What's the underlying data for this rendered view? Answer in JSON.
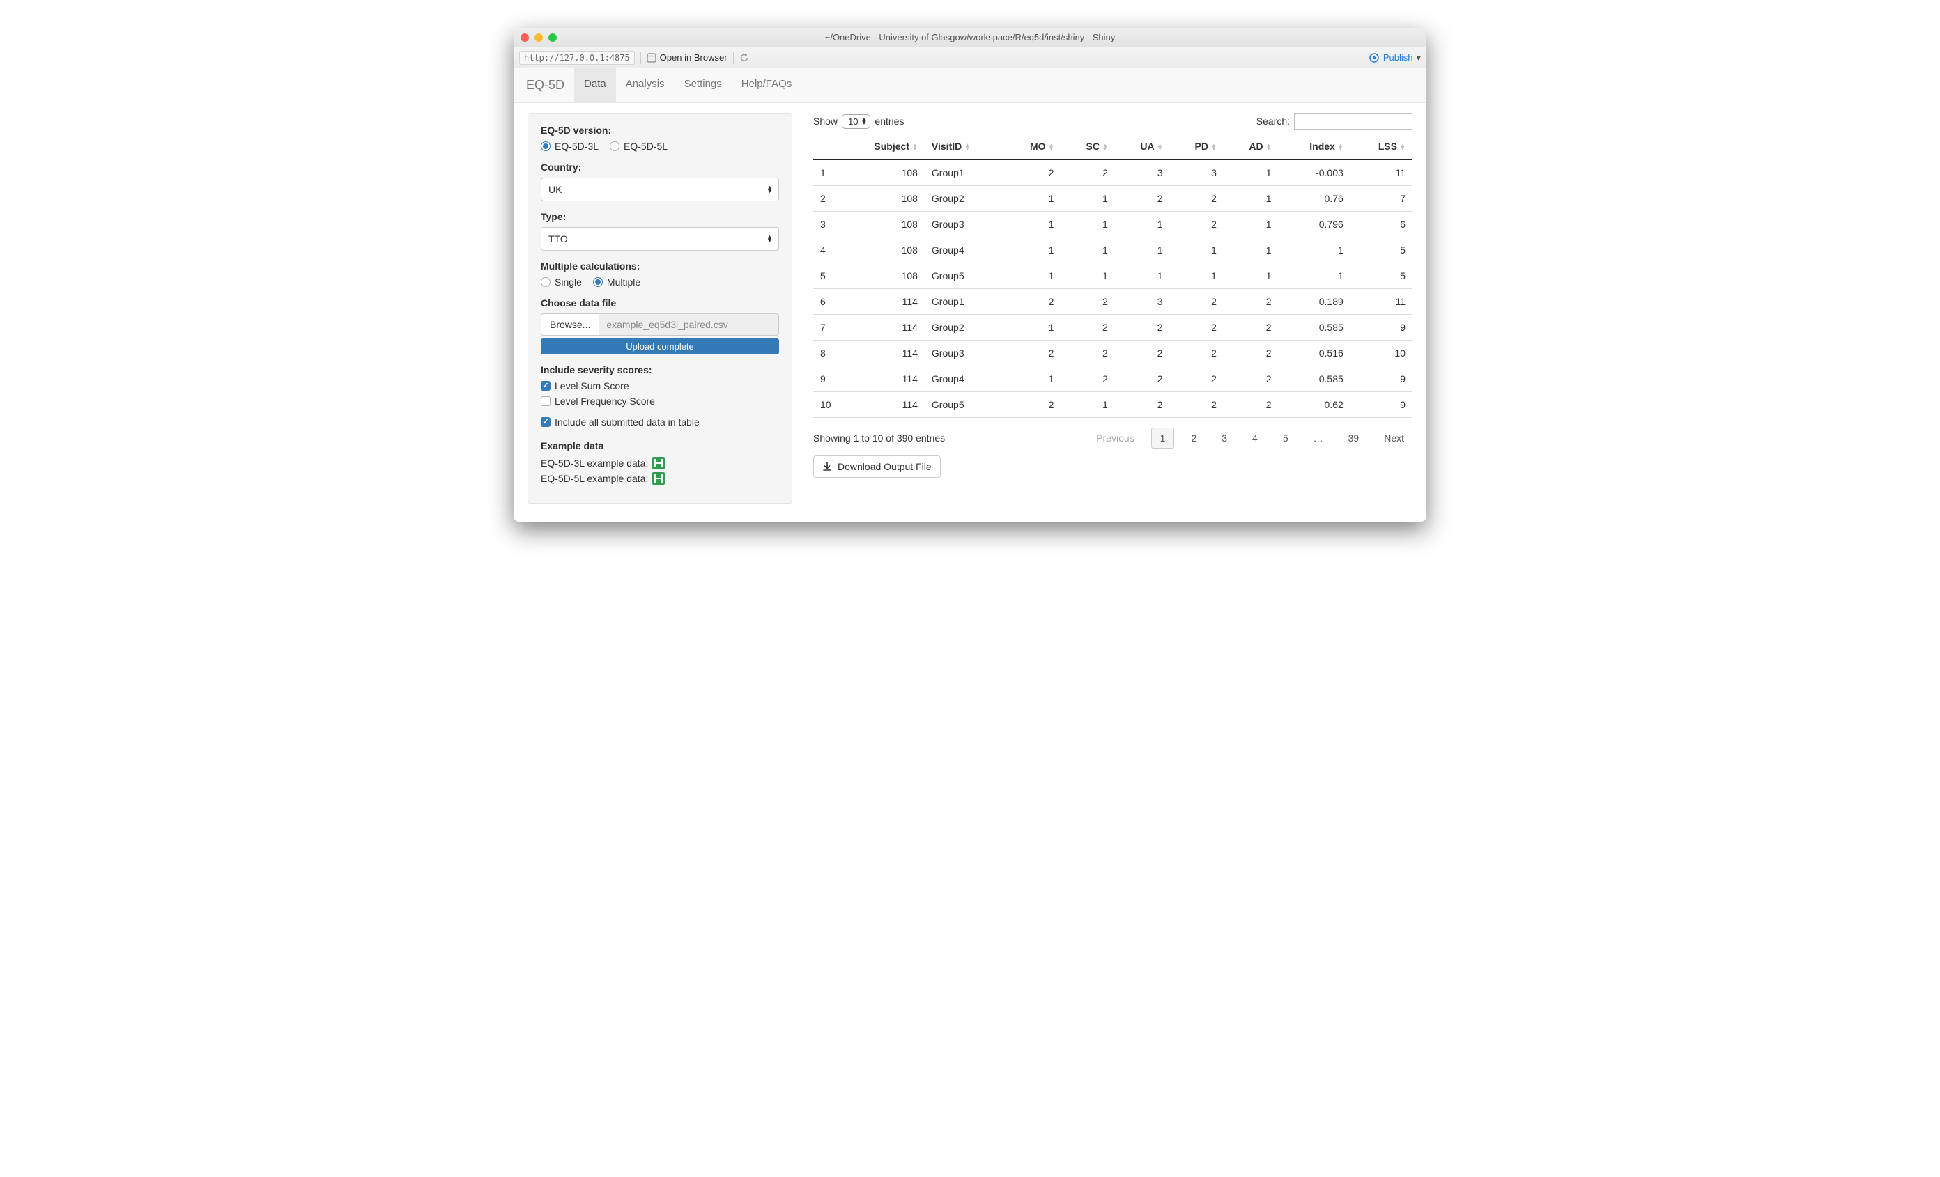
{
  "window": {
    "title": "~/OneDrive - University of Glasgow/workspace/R/eq5d/inst/shiny - Shiny",
    "url": "http://127.0.0.1:4875",
    "open_in_browser": "Open in Browser",
    "publish": "Publish"
  },
  "nav": {
    "brand": "EQ-5D",
    "tabs": [
      "Data",
      "Analysis",
      "Settings",
      "Help/FAQs"
    ],
    "active": "Data"
  },
  "sidebar": {
    "version_label": "EQ-5D version:",
    "version_options": [
      "EQ-5D-3L",
      "EQ-5D-5L"
    ],
    "version_selected": "EQ-5D-3L",
    "country_label": "Country:",
    "country_value": "UK",
    "type_label": "Type:",
    "type_value": "TTO",
    "multiple_label": "Multiple calculations:",
    "multiple_options": [
      "Single",
      "Multiple"
    ],
    "multiple_selected": "Multiple",
    "file_label": "Choose data file",
    "browse": "Browse...",
    "file_name": "example_eq5d3l_paired.csv",
    "upload_status": "Upload complete",
    "severity_label": "Include severity scores:",
    "severity_checks": [
      {
        "label": "Level Sum Score",
        "checked": true
      },
      {
        "label": "Level Frequency Score",
        "checked": false
      }
    ],
    "include_all": {
      "label": "Include all submitted data in table",
      "checked": true
    },
    "example_header": "Example data",
    "example_3l": "EQ-5D-3L example data:",
    "example_5l": "EQ-5D-5L example data:"
  },
  "table": {
    "show_prefix": "Show",
    "show_value": "10",
    "show_suffix": "entries",
    "search_label": "Search:",
    "columns": [
      "",
      "Subject",
      "VisitID",
      "MO",
      "SC",
      "UA",
      "PD",
      "AD",
      "Index",
      "LSS"
    ],
    "rows": [
      [
        "1",
        "108",
        "Group1",
        "2",
        "2",
        "3",
        "3",
        "1",
        "-0.003",
        "11"
      ],
      [
        "2",
        "108",
        "Group2",
        "1",
        "1",
        "2",
        "2",
        "1",
        "0.76",
        "7"
      ],
      [
        "3",
        "108",
        "Group3",
        "1",
        "1",
        "1",
        "2",
        "1",
        "0.796",
        "6"
      ],
      [
        "4",
        "108",
        "Group4",
        "1",
        "1",
        "1",
        "1",
        "1",
        "1",
        "5"
      ],
      [
        "5",
        "108",
        "Group5",
        "1",
        "1",
        "1",
        "1",
        "1",
        "1",
        "5"
      ],
      [
        "6",
        "114",
        "Group1",
        "2",
        "2",
        "3",
        "2",
        "2",
        "0.189",
        "11"
      ],
      [
        "7",
        "114",
        "Group2",
        "1",
        "2",
        "2",
        "2",
        "2",
        "0.585",
        "9"
      ],
      [
        "8",
        "114",
        "Group3",
        "2",
        "2",
        "2",
        "2",
        "2",
        "0.516",
        "10"
      ],
      [
        "9",
        "114",
        "Group4",
        "1",
        "2",
        "2",
        "2",
        "2",
        "0.585",
        "9"
      ],
      [
        "10",
        "114",
        "Group5",
        "2",
        "1",
        "2",
        "2",
        "2",
        "0.62",
        "9"
      ]
    ],
    "info": "Showing 1 to 10 of 390 entries",
    "pager": {
      "prev": "Previous",
      "pages": [
        "1",
        "2",
        "3",
        "4",
        "5",
        "…",
        "39"
      ],
      "active": "1",
      "next": "Next"
    },
    "download": "Download Output File"
  }
}
